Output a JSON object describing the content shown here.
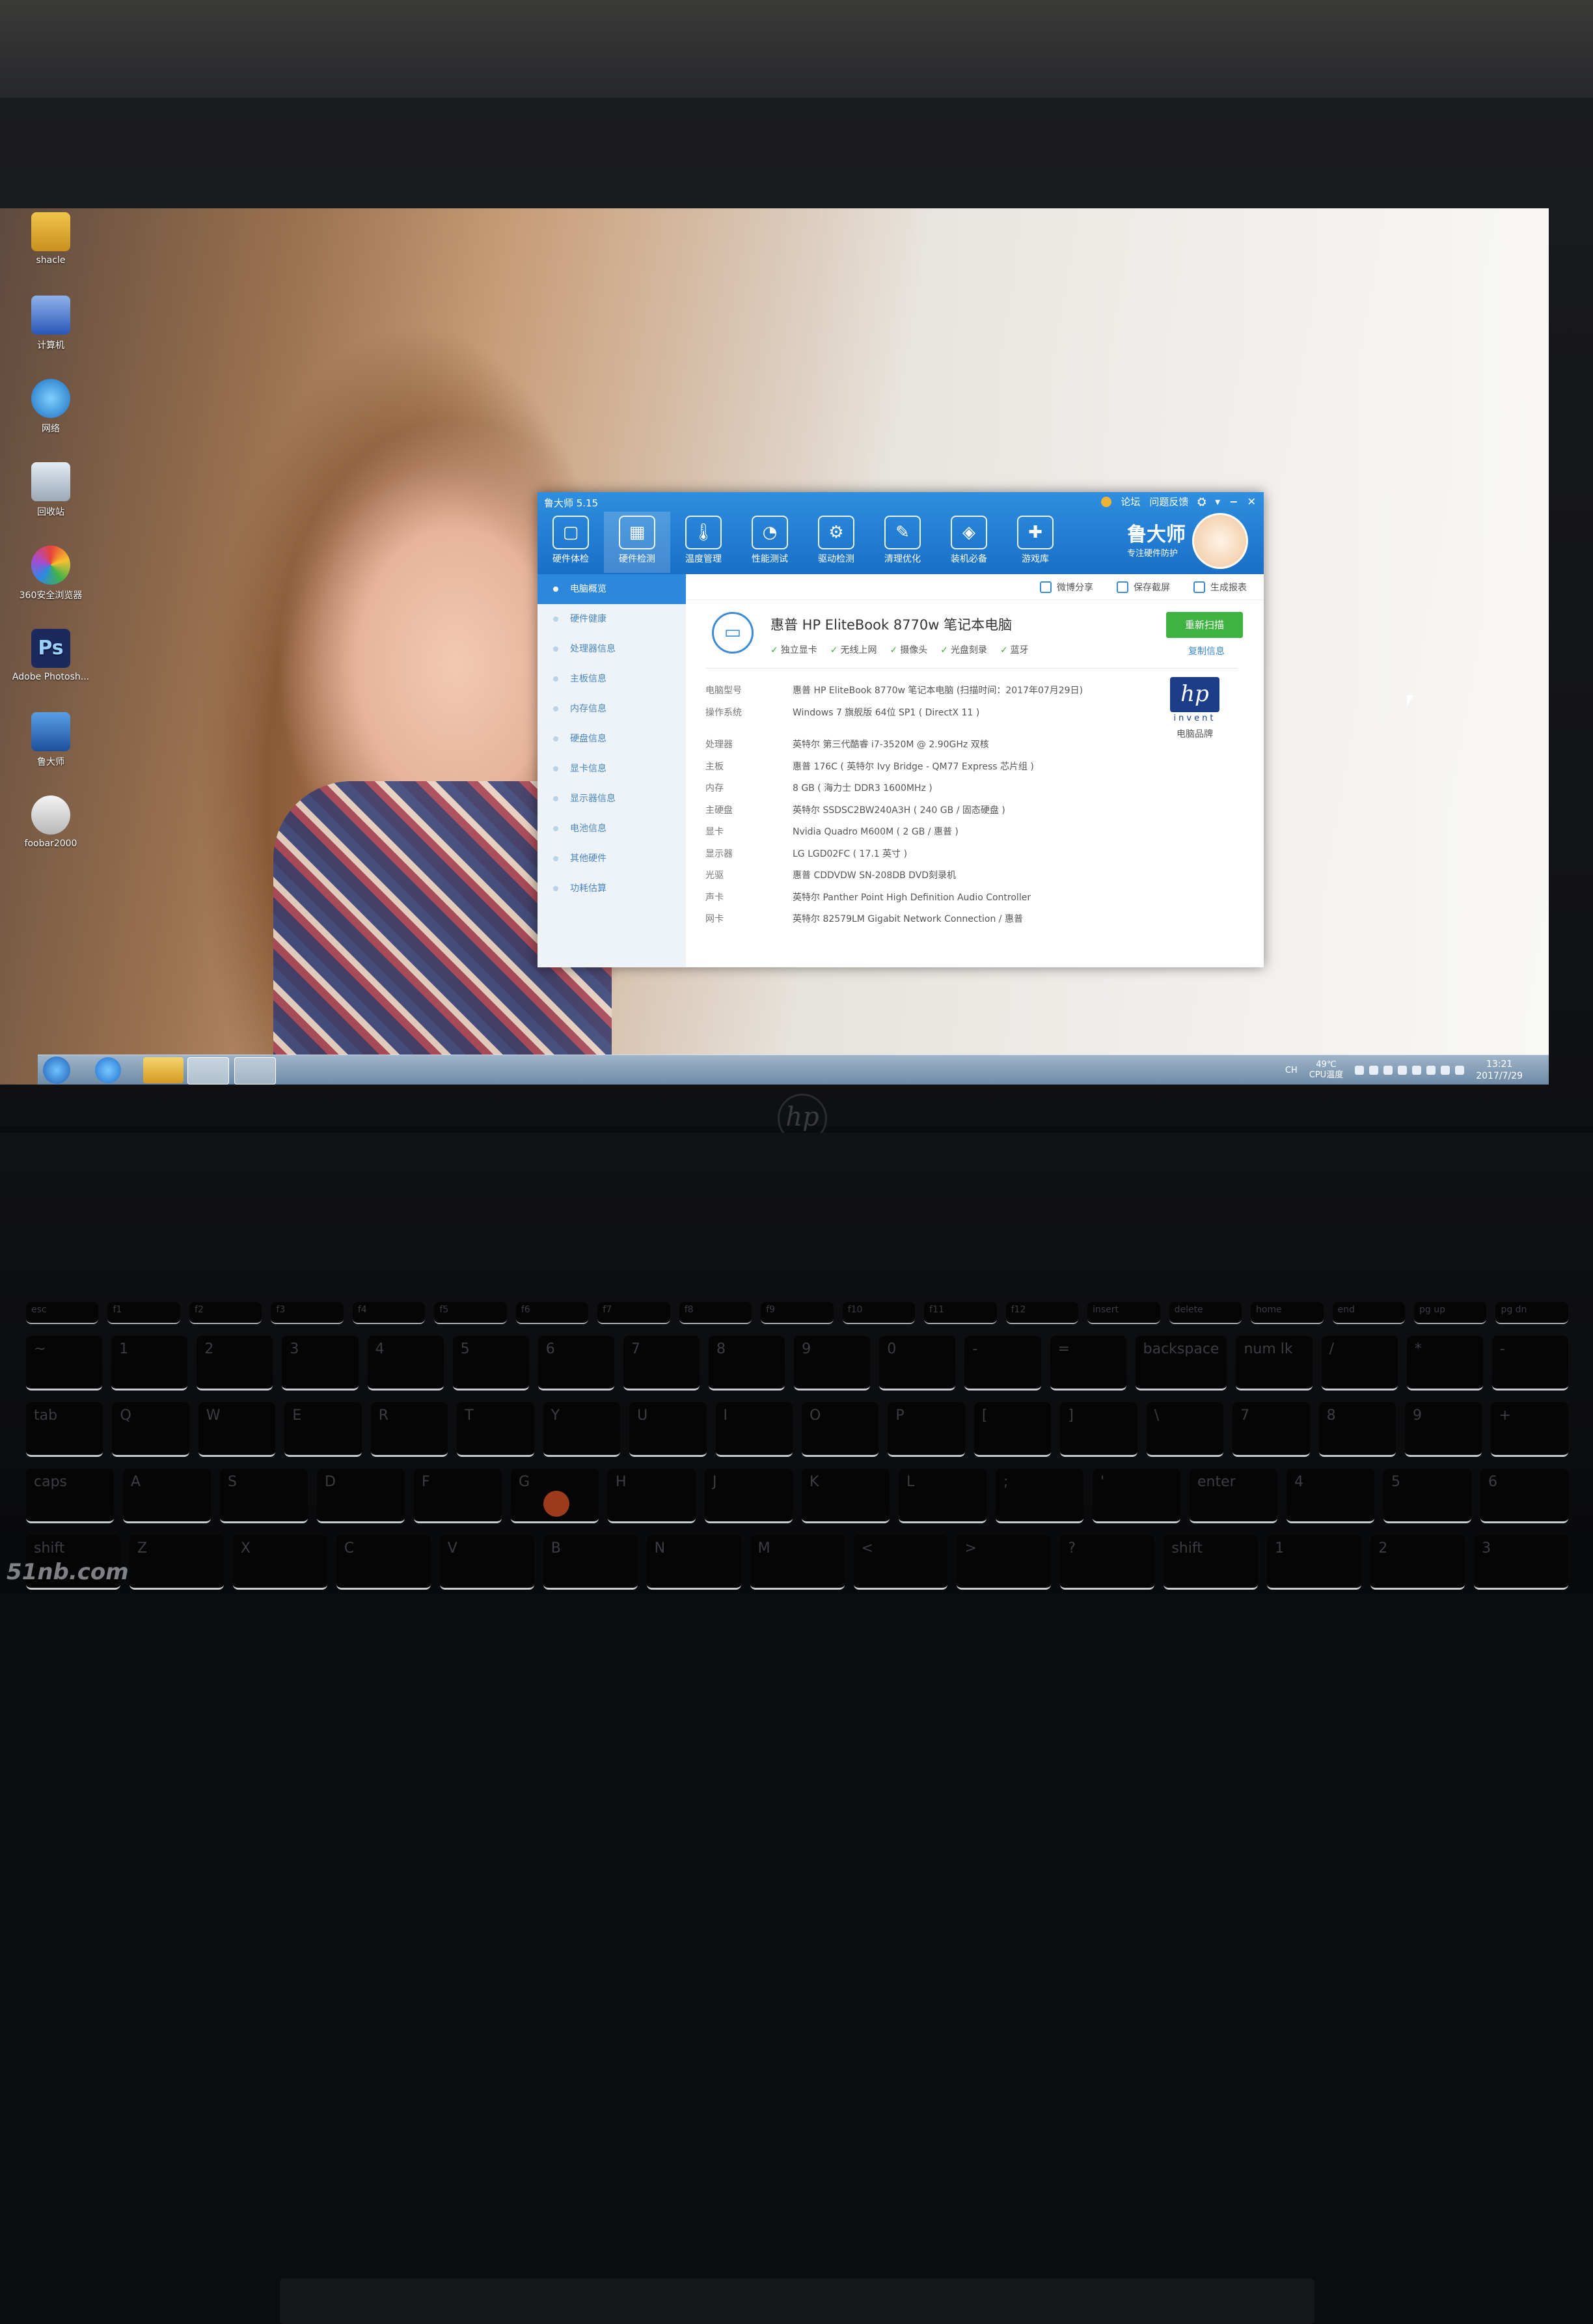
{
  "desktop": {
    "icons": [
      {
        "label": "shacle"
      },
      {
        "label": "计算机"
      },
      {
        "label": "网络"
      },
      {
        "label": "回收站"
      },
      {
        "label": "360安全浏览器"
      },
      {
        "label": "Adobe Photosh..."
      },
      {
        "label": "鲁大师"
      },
      {
        "label": "foobar2000"
      }
    ]
  },
  "window": {
    "title": "鲁大师 5.15",
    "top_links": [
      "论坛",
      "问题反馈"
    ],
    "controls": {
      "skin": "⛭",
      "menu": "▾",
      "minimize": "−",
      "close": "✕"
    },
    "tabs": [
      {
        "label": "硬件体检",
        "icon": "monitor-icon"
      },
      {
        "label": "硬件检测",
        "icon": "chip-board-icon"
      },
      {
        "label": "温度管理",
        "icon": "thermometer-icon"
      },
      {
        "label": "性能测试",
        "icon": "speedometer-icon"
      },
      {
        "label": "驱动检测",
        "icon": "gear-icon"
      },
      {
        "label": "清理优化",
        "icon": "broom-icon"
      },
      {
        "label": "装机必备",
        "icon": "cube-icon"
      },
      {
        "label": "游戏库",
        "icon": "gamepad-icon"
      }
    ],
    "brand": {
      "name": "鲁大师",
      "slogan": "专注硬件防护"
    },
    "sidebar": [
      {
        "label": "电脑概览"
      },
      {
        "label": "硬件健康"
      },
      {
        "label": "处理器信息"
      },
      {
        "label": "主板信息"
      },
      {
        "label": "内存信息"
      },
      {
        "label": "硬盘信息"
      },
      {
        "label": "显卡信息"
      },
      {
        "label": "显示器信息"
      },
      {
        "label": "电池信息"
      },
      {
        "label": "其他硬件"
      },
      {
        "label": "功耗估算"
      }
    ],
    "toolbar": {
      "share": "微博分享",
      "save": "保存截屏",
      "report": "生成报表"
    },
    "overview": {
      "pc_name": "惠普 HP EliteBook 8770w 笔记本电脑",
      "features": [
        "独立显卡",
        "无线上网",
        "摄像头",
        "光盘刻录",
        "蓝牙"
      ],
      "rescan": "重新扫描",
      "copy": "复制信息",
      "rows": [
        {
          "k": "电脑型号",
          "v": "惠普 HP EliteBook 8770w 笔记本电脑  (扫描时间：2017年07月29日)"
        },
        {
          "k": "操作系统",
          "v": "Windows 7 旗舰版 64位 SP1 ( DirectX 11 )"
        },
        {
          "k": "处理器",
          "v": "英特尔 第三代酷睿 i7-3520M @ 2.90GHz 双核"
        },
        {
          "k": "主板",
          "v": "惠普 176C ( 英特尔 Ivy Bridge - QM77 Express 芯片组 )"
        },
        {
          "k": "内存",
          "v": "8 GB ( 海力士 DDR3 1600MHz )"
        },
        {
          "k": "主硬盘",
          "v": "英特尔 SSDSC2BW240A3H ( 240 GB / 固态硬盘 )"
        },
        {
          "k": "显卡",
          "v": "Nvidia Quadro M600M ( 2 GB / 惠普 )"
        },
        {
          "k": "显示器",
          "v": "LG LGD02FC ( 17.1 英寸 )"
        },
        {
          "k": "光驱",
          "v": "惠普 CDDVDW SN-208DB DVD刻录机"
        },
        {
          "k": "声卡",
          "v": "英特尔 Panther Point High Definition Audio Controller"
        },
        {
          "k": "网卡",
          "v": "英特尔 82579LM Gigabit Network Connection / 惠普"
        }
      ],
      "brand_logo": {
        "text": "hp",
        "sub": "invent",
        "caption": "电脑品牌"
      }
    }
  },
  "taskbar": {
    "lang": "CH",
    "temp": "49℃",
    "temp_label": "CPU温度",
    "time": "13:21",
    "date": "2017/7/29"
  },
  "keyboard": {
    "frow": [
      "esc",
      "f1",
      "f2",
      "f3",
      "f4",
      "f5",
      "f6",
      "f7",
      "f8",
      "f9",
      "f10",
      "f11",
      "f12",
      "insert",
      "delete",
      "home",
      "end",
      "pg up",
      "pg dn"
    ],
    "row1": [
      "~",
      "1",
      "2",
      "3",
      "4",
      "5",
      "6",
      "7",
      "8",
      "9",
      "0",
      "-",
      "=",
      "backspace",
      "num lk",
      "/",
      "*",
      "-"
    ],
    "row2": [
      "tab",
      "Q",
      "W",
      "E",
      "R",
      "T",
      "Y",
      "U",
      "I",
      "O",
      "P",
      "[",
      "]",
      "\\",
      "7",
      "8",
      "9",
      "+"
    ],
    "row3": [
      "caps",
      "A",
      "S",
      "D",
      "F",
      "G",
      "H",
      "J",
      "K",
      "L",
      ";",
      "'",
      "enter",
      "4",
      "5",
      "6"
    ],
    "row4": [
      "shift",
      "Z",
      "X",
      "C",
      "V",
      "B",
      "N",
      "M",
      "<",
      ">",
      "?",
      "shift",
      "1",
      "2",
      "3"
    ]
  },
  "watermark": "51nb.com"
}
